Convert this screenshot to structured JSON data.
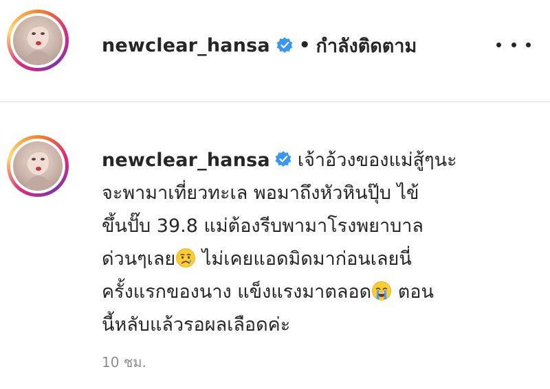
{
  "post": {
    "username": "newclear_hansa",
    "separator": "•",
    "follow_status": "กำลังติดตาม",
    "more_label": "more-options"
  },
  "caption": {
    "username": "newclear_hansa",
    "line1": "เจ้าอ้วงของแม่สู้ๆนะ",
    "line2": "จะพามาเที่ยวทะเล พอมาถึงหัวหินปุ๊บ ไข้",
    "line3": "ขึ้นปั๊บ 39.8 แม่ต้องรีบพามาโรงพยาบาล",
    "line4a": "ด่วนๆเลย",
    "line4b": " ไม่เคยแอดมิดมาก่อนเลยนี่",
    "line5a": "ครั้งแรกของนาง แข็งแรงมาตลอด",
    "line5b": " ตอน",
    "line6": "นี้หลับแล้วรอผลเลือดค่ะ",
    "emoji1": "sad-but-relieved-face",
    "emoji2": "loudly-crying-face"
  },
  "timestamp": "10 ชม.",
  "colors": {
    "verified": "#3897f0",
    "text": "#262626",
    "muted": "#8e8e8e",
    "divider": "#dbdbdb"
  }
}
